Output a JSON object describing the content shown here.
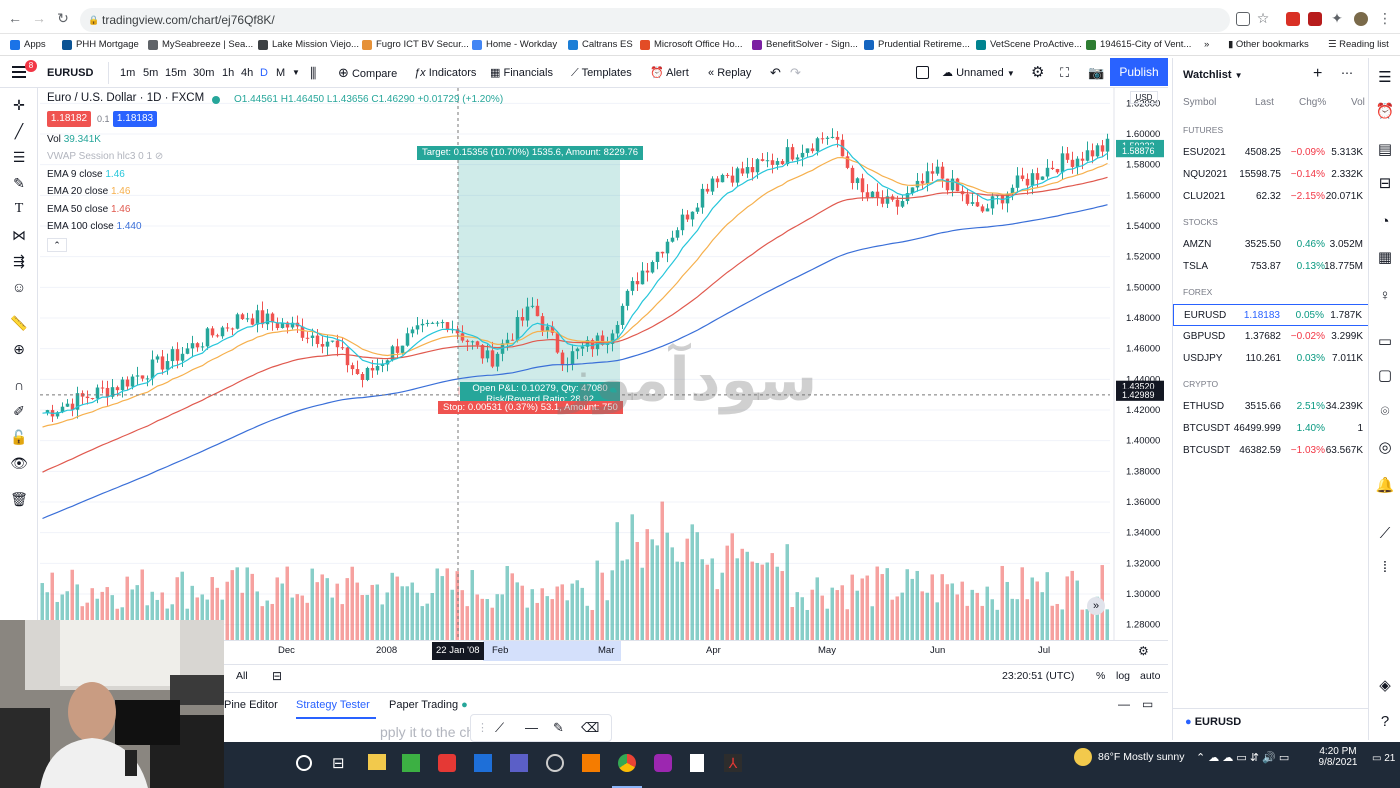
{
  "browser": {
    "url": "tradingview.com/chart/ej76Qf8K/",
    "bookmarks": [
      "Apps",
      "PHH Mortgage",
      "MySeabreeze | Sea...",
      "Lake Mission Viejo...",
      "Fugro ICT BV Secur...",
      "Home - Workday",
      "Caltrans ES",
      "Microsoft Office Ho...",
      "BenefitSolver - Sign...",
      "Prudential Retireme...",
      "VetScene ProActive...",
      "194615-City of Vent..."
    ],
    "other_bookmarks": "Other bookmarks",
    "reading_list": "Reading list",
    "overflow": "»"
  },
  "toolbar": {
    "symbol": "EURUSD",
    "intervals": [
      "1m",
      "5m",
      "15m",
      "30m",
      "1h",
      "4h",
      "D",
      "M"
    ],
    "compare": "Compare",
    "indicators": "Indicators",
    "financials": "Financials",
    "templates": "Templates",
    "alert": "Alert",
    "replay": "Replay",
    "layout": "Unnamed",
    "publish": "Publish",
    "menu_badge": "8"
  },
  "legend": {
    "title": "Euro / U.S. Dollar · 1D · FXCM",
    "o": "O1.44561",
    "h": "H1.46450",
    "l": "L1.43656",
    "c": "C1.46290",
    "chg": "+0.01729 (+1.20%)",
    "sell": "1.18182",
    "spread": "0.1",
    "buy": "1.18183",
    "vol_label": "Vol",
    "vol": "39.341K",
    "vwap": "VWAP Session hlc3 0 1",
    "ema9": "EMA 9 close",
    "ema9v": "1.46",
    "ema20": "EMA 20 close",
    "ema20v": "1.46",
    "ema50": "EMA 50 close",
    "ema50v": "1.46",
    "ema100": "EMA 100 close",
    "ema100v": "1.440"
  },
  "position": {
    "target": "Target: 0.15356 (10.70%) 1535.6, Amount: 8229.76",
    "open": "Open P&L: 0.10279, Qty: 47080",
    "rr": "Risk/Reward Ratio: 28.92",
    "stop": "Stop: 0.00531 (0.37%) 53.1, Amount: 750"
  },
  "price_axis": {
    "currency": "USD",
    "ticks": [
      "1.62000",
      "1.60000",
      "1.58000",
      "1.56000",
      "1.54000",
      "1.52000",
      "1.50000",
      "1.48000",
      "1.46000",
      "1.44000",
      "1.42000",
      "1.40000",
      "1.38000",
      "1.36000",
      "1.34000",
      "1.32000",
      "1.30000",
      "1.28000"
    ],
    "tags": [
      {
        "v": "1.59222",
        "c": "#26a69a"
      },
      {
        "v": "1.58876",
        "c": "#26a69a"
      },
      {
        "v": "1.43520",
        "c": "#131722"
      },
      {
        "v": "1.42989",
        "c": "#131722"
      }
    ]
  },
  "time_axis": {
    "ticks": [
      "Dec",
      "2008",
      "Feb",
      "Mar",
      "Apr",
      "May",
      "Jun",
      "Jul"
    ],
    "cursor": "22 Jan '08"
  },
  "status": {
    "range": "All",
    "time": "23:20:51 (UTC)",
    "pct": "%",
    "log": "log",
    "auto": "auto"
  },
  "bottom_tabs": {
    "pine": "Pine Editor",
    "strategy": "Strategy Tester",
    "paper": "Paper Trading",
    "hint": "pply it to the chart."
  },
  "watchlist": {
    "title": "Watchlist",
    "cols": [
      "Symbol",
      "Last",
      "Chg%",
      "Vol"
    ],
    "sections": [
      {
        "name": "FUTURES",
        "rows": [
          {
            "s": "ESU2021",
            "l": "4508.25",
            "c": "−0.09%",
            "v": "5.313K",
            "neg": true
          },
          {
            "s": "NQU2021",
            "l": "15598.75",
            "c": "−0.14%",
            "v": "2.332K",
            "neg": true
          },
          {
            "s": "CLU2021",
            "l": "62.32",
            "c": "−2.15%",
            "v": "20.071K",
            "neg": true
          }
        ]
      },
      {
        "name": "STOCKS",
        "rows": [
          {
            "s": "AMZN",
            "l": "3525.50",
            "c": "0.46%",
            "v": "3.052M",
            "neg": false
          },
          {
            "s": "TSLA",
            "l": "753.87",
            "c": "0.13%",
            "v": "18.775M",
            "neg": false
          }
        ]
      },
      {
        "name": "FOREX",
        "rows": [
          {
            "s": "EURUSD",
            "l": "1.18183",
            "c": "0.05%",
            "v": "1.787K",
            "neg": false
          },
          {
            "s": "GBPUSD",
            "l": "1.37682",
            "c": "−0.02%",
            "v": "3.299K",
            "neg": true
          },
          {
            "s": "USDJPY",
            "l": "110.261",
            "c": "0.03%",
            "v": "7.011K",
            "neg": false
          }
        ]
      },
      {
        "name": "CRYPTO",
        "rows": [
          {
            "s": "ETHUSD",
            "l": "3515.66",
            "c": "2.51%",
            "v": "34.239K",
            "neg": false
          },
          {
            "s": "BTCUSDT",
            "l": "46499.999",
            "c": "1.40%",
            "v": "1",
            "neg": false
          },
          {
            "s": "BTCUSDT",
            "l": "46382.59",
            "c": "−1.03%",
            "v": "63.567K",
            "neg": true
          }
        ]
      }
    ],
    "footer": "EURUSD"
  },
  "taskbar": {
    "weather": "86°F  Mostly sunny",
    "time": "4:20 PM",
    "date": "9/8/2021",
    "notif": "21"
  },
  "watermark": "سودآموز",
  "colors": {
    "up": "#26a69a",
    "down": "#ef5350",
    "accent": "#2962ff",
    "ema9": "#26c6da",
    "ema20": "#f6b04d",
    "ema50": "#e0594e",
    "ema100": "#3a6fd8"
  },
  "chart_data": {
    "type": "candlestick",
    "symbol": "EURUSD",
    "timeframe": "1D",
    "ylim": [
      1.27,
      1.63
    ],
    "x_range": [
      "Nov 2007",
      "Aug 2008"
    ],
    "anchors": [
      {
        "t": 0,
        "p": 1.418
      },
      {
        "t": 0.07,
        "p": 1.436
      },
      {
        "t": 0.13,
        "p": 1.457
      },
      {
        "t": 0.19,
        "p": 1.482
      },
      {
        "t": 0.23,
        "p": 1.475
      },
      {
        "t": 0.27,
        "p": 1.465
      },
      {
        "t": 0.3,
        "p": 1.44
      },
      {
        "t": 0.34,
        "p": 1.466
      },
      {
        "t": 0.38,
        "p": 1.478
      },
      {
        "t": 0.42,
        "p": 1.452
      },
      {
        "t": 0.46,
        "p": 1.487
      },
      {
        "t": 0.49,
        "p": 1.453
      },
      {
        "t": 0.53,
        "p": 1.468
      },
      {
        "t": 0.56,
        "p": 1.508
      },
      {
        "t": 0.6,
        "p": 1.543
      },
      {
        "t": 0.63,
        "p": 1.573
      },
      {
        "t": 0.66,
        "p": 1.575
      },
      {
        "t": 0.7,
        "p": 1.587
      },
      {
        "t": 0.74,
        "p": 1.6
      },
      {
        "t": 0.77,
        "p": 1.56
      },
      {
        "t": 0.8,
        "p": 1.552
      },
      {
        "t": 0.84,
        "p": 1.575
      },
      {
        "t": 0.88,
        "p": 1.548
      },
      {
        "t": 0.91,
        "p": 1.565
      },
      {
        "t": 0.95,
        "p": 1.58
      },
      {
        "t": 1.0,
        "p": 1.592
      }
    ]
  }
}
